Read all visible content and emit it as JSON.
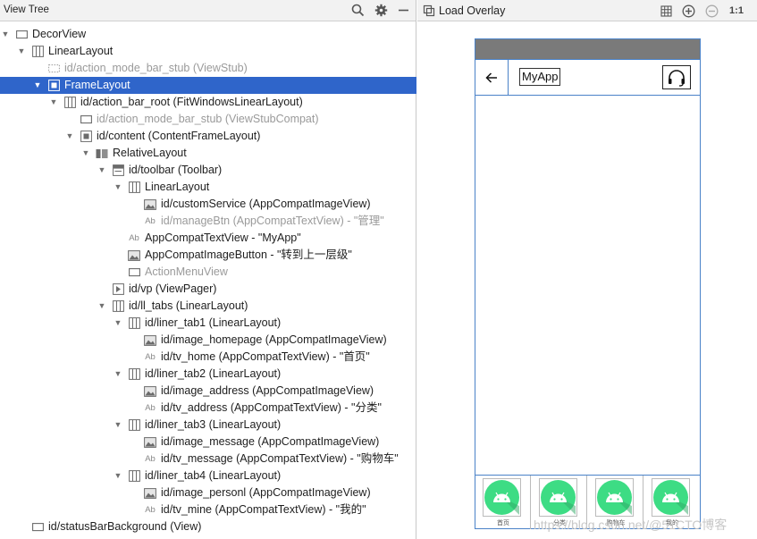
{
  "left_panel": {
    "title": "View Tree",
    "icons": [
      "search-icon",
      "gear-icon",
      "minimize-icon"
    ]
  },
  "tree": [
    {
      "label": "DecorView",
      "icon": "rect",
      "arrow": "open",
      "dim": false
    },
    {
      "label": "LinearLayout",
      "icon": "columns",
      "arrow": "open",
      "dim": false
    },
    {
      "label": "id/action_mode_bar_stub (ViewStub)",
      "icon": "dotted",
      "arrow": "",
      "dim": true
    },
    {
      "label": "FrameLayout",
      "icon": "frame",
      "arrow": "open",
      "dim": false,
      "selected": true
    },
    {
      "label": "id/action_bar_root (FitWindowsLinearLayout)",
      "icon": "columns",
      "arrow": "open",
      "dim": false
    },
    {
      "label": "id/action_mode_bar_stub (ViewStubCompat)",
      "icon": "rect",
      "arrow": "",
      "dim": true
    },
    {
      "label": "id/content (ContentFrameLayout)",
      "icon": "frame",
      "arrow": "open",
      "dim": false
    },
    {
      "label": "RelativeLayout",
      "icon": "relative",
      "arrow": "open",
      "dim": false
    },
    {
      "label": "id/toolbar (Toolbar)",
      "icon": "toolbar",
      "arrow": "open",
      "dim": false
    },
    {
      "label": "LinearLayout",
      "icon": "columns",
      "arrow": "open",
      "dim": false
    },
    {
      "label": "id/customService (AppCompatImageView)",
      "icon": "image",
      "arrow": "",
      "dim": false
    },
    {
      "label": "id/manageBtn (AppCompatTextView) - \"管理\"",
      "icon": "text",
      "arrow": "",
      "dim": true
    },
    {
      "label": "AppCompatTextView - \"MyApp\"",
      "icon": "text",
      "arrow": "",
      "dim": false
    },
    {
      "label": "AppCompatImageButton - \"转到上一层级\"",
      "icon": "image",
      "arrow": "",
      "dim": false
    },
    {
      "label": "ActionMenuView",
      "icon": "rect",
      "arrow": "",
      "dim": true
    },
    {
      "label": "id/vp (ViewPager)",
      "icon": "pager",
      "arrow": "",
      "dim": false
    },
    {
      "label": "id/ll_tabs (LinearLayout)",
      "icon": "columns",
      "arrow": "open",
      "dim": false
    },
    {
      "label": "id/liner_tab1 (LinearLayout)",
      "icon": "columns",
      "arrow": "open",
      "dim": false
    },
    {
      "label": "id/image_homepage (AppCompatImageView)",
      "icon": "image",
      "arrow": "",
      "dim": false
    },
    {
      "label": "id/tv_home (AppCompatTextView) - \"首页\"",
      "icon": "text",
      "arrow": "",
      "dim": false
    },
    {
      "label": "id/liner_tab2 (LinearLayout)",
      "icon": "columns",
      "arrow": "open",
      "dim": false
    },
    {
      "label": "id/image_address (AppCompatImageView)",
      "icon": "image",
      "arrow": "",
      "dim": false
    },
    {
      "label": "id/tv_address (AppCompatTextView) - \"分类\"",
      "icon": "text",
      "arrow": "",
      "dim": false
    },
    {
      "label": "id/liner_tab3 (LinearLayout)",
      "icon": "columns",
      "arrow": "open",
      "dim": false
    },
    {
      "label": "id/image_message (AppCompatImageView)",
      "icon": "image",
      "arrow": "",
      "dim": false
    },
    {
      "label": "id/tv_message (AppCompatTextView) - \"购物车\"",
      "icon": "text",
      "arrow": "",
      "dim": false
    },
    {
      "label": "id/liner_tab4 (LinearLayout)",
      "icon": "columns",
      "arrow": "open",
      "dim": false
    },
    {
      "label": "id/image_personl (AppCompatImageView)",
      "icon": "image",
      "arrow": "",
      "dim": false
    },
    {
      "label": "id/tv_mine (AppCompatTextView) - \"我的\"",
      "icon": "text",
      "arrow": "",
      "dim": false
    },
    {
      "label": "id/statusBarBackground (View)",
      "icon": "rect",
      "arrow": "",
      "dim": false
    }
  ],
  "right_panel": {
    "load_overlay": "Load Overlay",
    "zoom_label": "1:1",
    "icons": [
      "overlay-icon",
      "grid-icon",
      "zoom-in-icon",
      "zoom-out-icon"
    ]
  },
  "device": {
    "back_icon": "arrow-left-icon",
    "title": "MyApp",
    "headset_icon": "headset-icon",
    "tabs": [
      {
        "label": "首页",
        "icon": "android-icon"
      },
      {
        "label": "分类",
        "icon": "android-icon"
      },
      {
        "label": "购物车",
        "icon": "android-icon"
      },
      {
        "label": "我的",
        "icon": "android-icon"
      }
    ],
    "android_color": "#3ddc84",
    "statusbar_color": "#7a7a7a",
    "outline_color": "#4a82c8"
  },
  "watermark": "https://blog.csdn.net/@51CTO博客",
  "colors": {
    "selection": "#2f65ca"
  }
}
